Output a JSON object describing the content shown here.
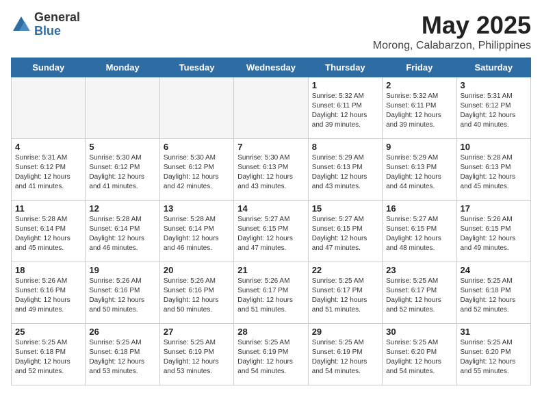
{
  "logo": {
    "general": "General",
    "blue": "Blue"
  },
  "header": {
    "month": "May 2025",
    "location": "Morong, Calabarzon, Philippines"
  },
  "weekdays": [
    "Sunday",
    "Monday",
    "Tuesday",
    "Wednesday",
    "Thursday",
    "Friday",
    "Saturday"
  ],
  "weeks": [
    [
      {
        "day": "",
        "info": ""
      },
      {
        "day": "",
        "info": ""
      },
      {
        "day": "",
        "info": ""
      },
      {
        "day": "",
        "info": ""
      },
      {
        "day": "1",
        "info": "Sunrise: 5:32 AM\nSunset: 6:11 PM\nDaylight: 12 hours\nand 39 minutes."
      },
      {
        "day": "2",
        "info": "Sunrise: 5:32 AM\nSunset: 6:11 PM\nDaylight: 12 hours\nand 39 minutes."
      },
      {
        "day": "3",
        "info": "Sunrise: 5:31 AM\nSunset: 6:12 PM\nDaylight: 12 hours\nand 40 minutes."
      }
    ],
    [
      {
        "day": "4",
        "info": "Sunrise: 5:31 AM\nSunset: 6:12 PM\nDaylight: 12 hours\nand 41 minutes."
      },
      {
        "day": "5",
        "info": "Sunrise: 5:30 AM\nSunset: 6:12 PM\nDaylight: 12 hours\nand 41 minutes."
      },
      {
        "day": "6",
        "info": "Sunrise: 5:30 AM\nSunset: 6:12 PM\nDaylight: 12 hours\nand 42 minutes."
      },
      {
        "day": "7",
        "info": "Sunrise: 5:30 AM\nSunset: 6:13 PM\nDaylight: 12 hours\nand 43 minutes."
      },
      {
        "day": "8",
        "info": "Sunrise: 5:29 AM\nSunset: 6:13 PM\nDaylight: 12 hours\nand 43 minutes."
      },
      {
        "day": "9",
        "info": "Sunrise: 5:29 AM\nSunset: 6:13 PM\nDaylight: 12 hours\nand 44 minutes."
      },
      {
        "day": "10",
        "info": "Sunrise: 5:28 AM\nSunset: 6:13 PM\nDaylight: 12 hours\nand 45 minutes."
      }
    ],
    [
      {
        "day": "11",
        "info": "Sunrise: 5:28 AM\nSunset: 6:14 PM\nDaylight: 12 hours\nand 45 minutes."
      },
      {
        "day": "12",
        "info": "Sunrise: 5:28 AM\nSunset: 6:14 PM\nDaylight: 12 hours\nand 46 minutes."
      },
      {
        "day": "13",
        "info": "Sunrise: 5:28 AM\nSunset: 6:14 PM\nDaylight: 12 hours\nand 46 minutes."
      },
      {
        "day": "14",
        "info": "Sunrise: 5:27 AM\nSunset: 6:15 PM\nDaylight: 12 hours\nand 47 minutes."
      },
      {
        "day": "15",
        "info": "Sunrise: 5:27 AM\nSunset: 6:15 PM\nDaylight: 12 hours\nand 47 minutes."
      },
      {
        "day": "16",
        "info": "Sunrise: 5:27 AM\nSunset: 6:15 PM\nDaylight: 12 hours\nand 48 minutes."
      },
      {
        "day": "17",
        "info": "Sunrise: 5:26 AM\nSunset: 6:15 PM\nDaylight: 12 hours\nand 49 minutes."
      }
    ],
    [
      {
        "day": "18",
        "info": "Sunrise: 5:26 AM\nSunset: 6:16 PM\nDaylight: 12 hours\nand 49 minutes."
      },
      {
        "day": "19",
        "info": "Sunrise: 5:26 AM\nSunset: 6:16 PM\nDaylight: 12 hours\nand 50 minutes."
      },
      {
        "day": "20",
        "info": "Sunrise: 5:26 AM\nSunset: 6:16 PM\nDaylight: 12 hours\nand 50 minutes."
      },
      {
        "day": "21",
        "info": "Sunrise: 5:26 AM\nSunset: 6:17 PM\nDaylight: 12 hours\nand 51 minutes."
      },
      {
        "day": "22",
        "info": "Sunrise: 5:25 AM\nSunset: 6:17 PM\nDaylight: 12 hours\nand 51 minutes."
      },
      {
        "day": "23",
        "info": "Sunrise: 5:25 AM\nSunset: 6:17 PM\nDaylight: 12 hours\nand 52 minutes."
      },
      {
        "day": "24",
        "info": "Sunrise: 5:25 AM\nSunset: 6:18 PM\nDaylight: 12 hours\nand 52 minutes."
      }
    ],
    [
      {
        "day": "25",
        "info": "Sunrise: 5:25 AM\nSunset: 6:18 PM\nDaylight: 12 hours\nand 52 minutes."
      },
      {
        "day": "26",
        "info": "Sunrise: 5:25 AM\nSunset: 6:18 PM\nDaylight: 12 hours\nand 53 minutes."
      },
      {
        "day": "27",
        "info": "Sunrise: 5:25 AM\nSunset: 6:19 PM\nDaylight: 12 hours\nand 53 minutes."
      },
      {
        "day": "28",
        "info": "Sunrise: 5:25 AM\nSunset: 6:19 PM\nDaylight: 12 hours\nand 54 minutes."
      },
      {
        "day": "29",
        "info": "Sunrise: 5:25 AM\nSunset: 6:19 PM\nDaylight: 12 hours\nand 54 minutes."
      },
      {
        "day": "30",
        "info": "Sunrise: 5:25 AM\nSunset: 6:20 PM\nDaylight: 12 hours\nand 54 minutes."
      },
      {
        "day": "31",
        "info": "Sunrise: 5:25 AM\nSunset: 6:20 PM\nDaylight: 12 hours\nand 55 minutes."
      }
    ]
  ]
}
